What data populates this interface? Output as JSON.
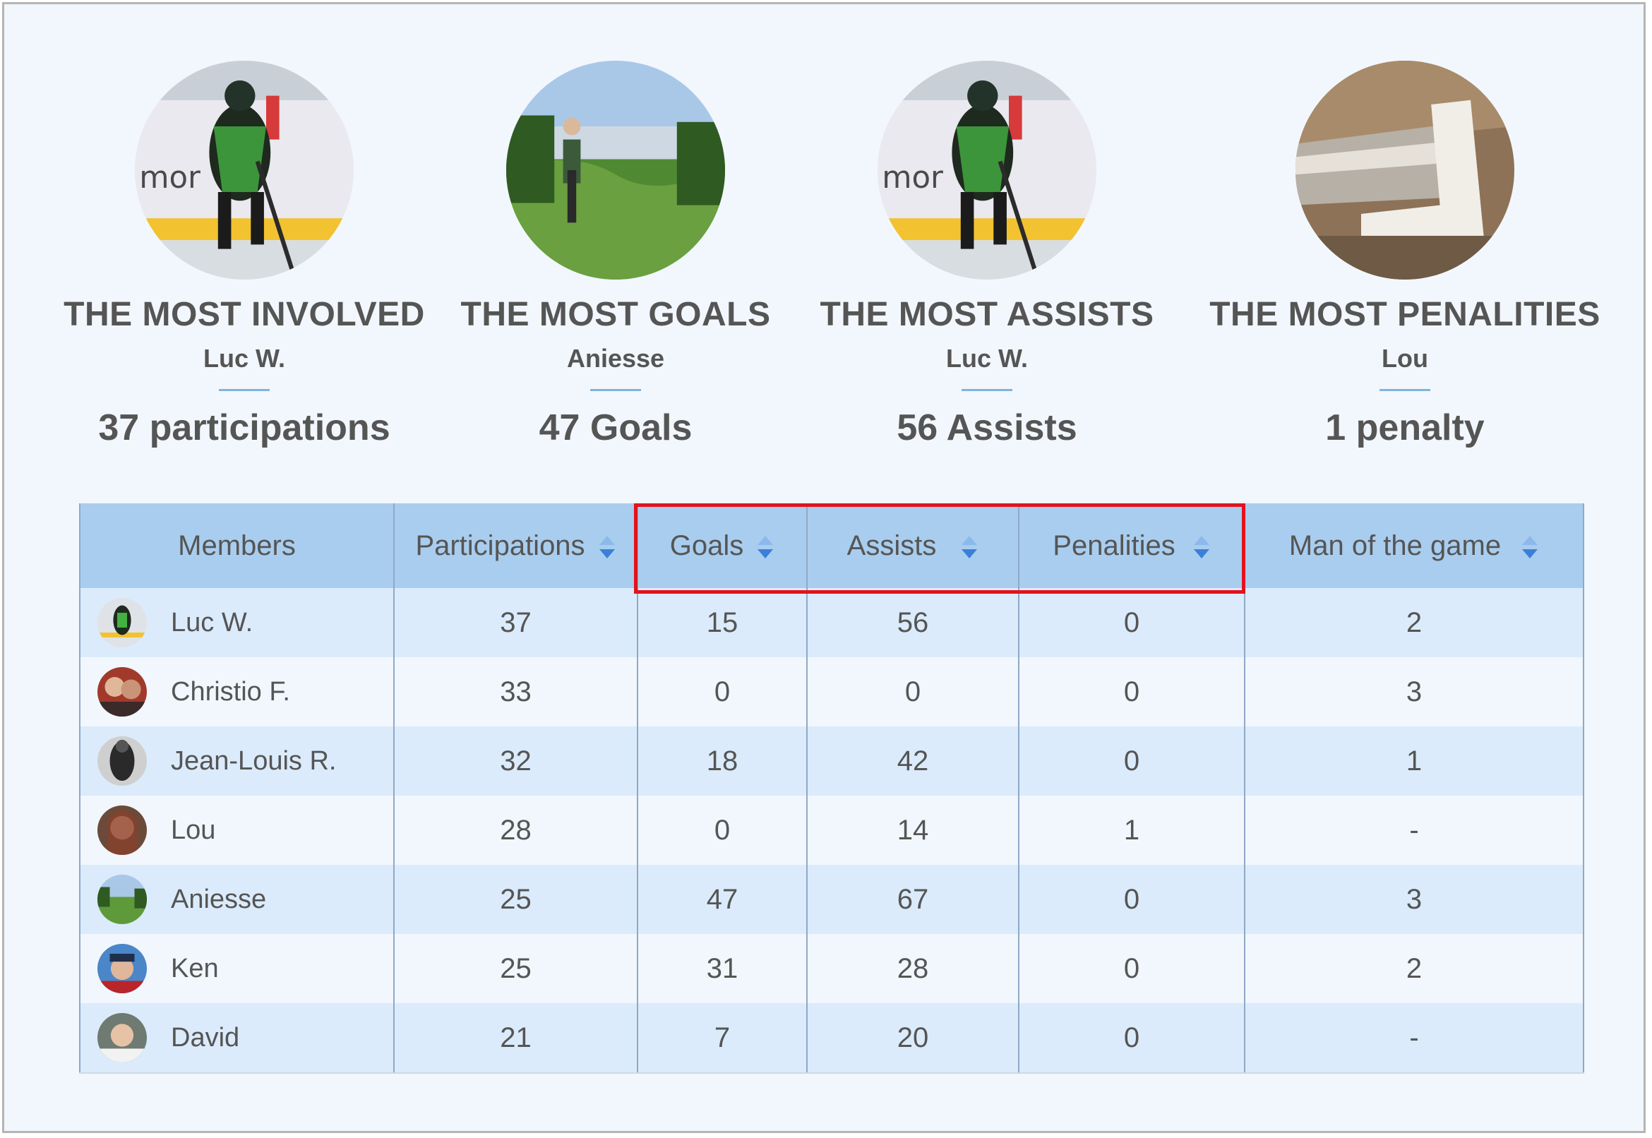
{
  "highlights": [
    {
      "title": "THE MOST INVOLVED",
      "name": "Luc W.",
      "stat": "37 participations",
      "avatar": "hockey-player-photo"
    },
    {
      "title": "THE MOST GOALS",
      "name": "Aniesse",
      "stat": "47 Goals",
      "avatar": "field-landscape-photo"
    },
    {
      "title": "THE MOST ASSISTS",
      "name": "Luc W.",
      "stat": "56 Assists",
      "avatar": "hockey-player-photo"
    },
    {
      "title": "THE MOST PENALITIES",
      "name": "Lou",
      "stat": "1 penalty",
      "avatar": "metal-pipe-photo"
    }
  ],
  "table": {
    "columns": [
      "Members",
      "Participations",
      "Goals",
      "Assists",
      "Penalities",
      "Man of the game"
    ],
    "rows": [
      {
        "member": "Luc W.",
        "participations": "37",
        "goals": "15",
        "assists": "56",
        "penalities": "0",
        "motg": "2",
        "avatar": "hockey-player-photo"
      },
      {
        "member": "Christio F.",
        "participations": "33",
        "goals": "0",
        "assists": "0",
        "penalities": "0",
        "motg": "3",
        "avatar": "couple-photo"
      },
      {
        "member": "Jean-Louis R.",
        "participations": "32",
        "goals": "18",
        "assists": "42",
        "penalities": "0",
        "motg": "1",
        "avatar": "bw-hockey-photo"
      },
      {
        "member": "Lou",
        "participations": "28",
        "goals": "0",
        "assists": "14",
        "penalities": "1",
        "motg": "-",
        "avatar": "portrait-photo"
      },
      {
        "member": "Aniesse",
        "participations": "25",
        "goals": "47",
        "assists": "67",
        "penalities": "0",
        "motg": "3",
        "avatar": "field-landscape-photo"
      },
      {
        "member": "Ken",
        "participations": "25",
        "goals": "31",
        "assists": "28",
        "penalities": "0",
        "motg": "2",
        "avatar": "man-cap-photo"
      },
      {
        "member": "David",
        "participations": "21",
        "goals": "7",
        "assists": "20",
        "penalities": "0",
        "motg": "-",
        "avatar": "smiling-man-photo"
      }
    ]
  },
  "colors": {
    "header_bg": "#a9cdee",
    "row_even": "#dbebfb",
    "row_odd": "#f1f7fd",
    "sort_arrow": "#3b7fd9",
    "highlight_border": "#e3121e"
  }
}
